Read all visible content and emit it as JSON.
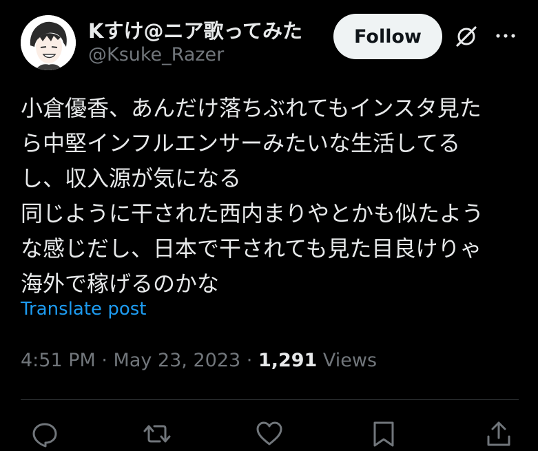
{
  "author": {
    "display_name": "Kすけ@ニア歌ってみた",
    "handle": "@Ksuke_Razer",
    "avatar_icon": "user-avatar"
  },
  "follow_label": "Follow",
  "header_icons": [
    "grok-icon",
    "more-icon"
  ],
  "post": {
    "lines": [
      "小倉優香、あんだけ落ちぶれてもインスタ見た",
      "ら中堅インフルエンサーみたいな生活してる",
      "し、収入源が気になる",
      "同じように干された西内まりやとかも似たよう",
      "な感じだし、日本で干されても見た目良けりゃ",
      "海外で稼げるのかな"
    ]
  },
  "translate_label": "Translate post",
  "meta": {
    "time": "4:51 PM",
    "sep1": " · ",
    "date": "May 23, 2023",
    "sep2": " · ",
    "views_count": "1,291",
    "views_label": " Views"
  },
  "actions": [
    "reply-icon",
    "repost-icon",
    "like-icon",
    "bookmark-icon",
    "share-icon"
  ],
  "colors": {
    "background": "#000000",
    "text": "#e7e9ea",
    "muted": "#71767b",
    "link": "#1d9bf0",
    "follow_bg": "#eff3f4",
    "divider": "#2f3336"
  }
}
